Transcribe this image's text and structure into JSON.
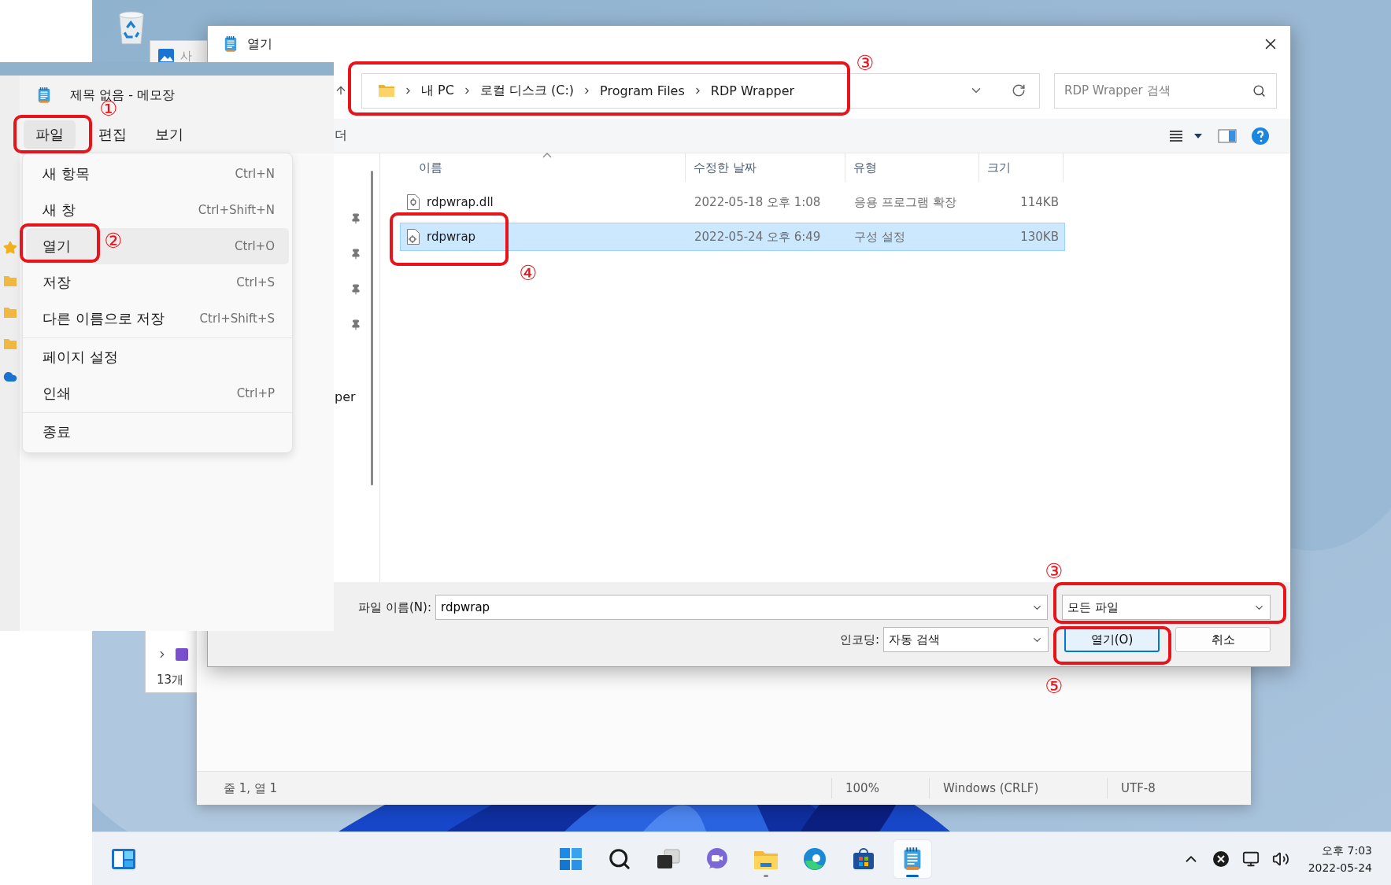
{
  "photo_window": {
    "title": "사"
  },
  "explorer_window": {
    "status": "13개"
  },
  "open_dialog": {
    "title": "열기",
    "breadcrumb": [
      "내 PC",
      "로컬 디스크 (C:)",
      "Program Files",
      "RDP Wrapper"
    ],
    "search": {
      "placeholder": "RDP Wrapper 검색"
    },
    "toolbar_text": "더",
    "nav_text": "per",
    "columns": [
      {
        "label": "이름",
        "sorted": true
      },
      {
        "label": "수정한 날짜",
        "sorted": false
      },
      {
        "label": "유형",
        "sorted": false
      },
      {
        "label": "크기",
        "sorted": false
      }
    ],
    "files": [
      {
        "name": "rdpwrap.dll",
        "modified": "2022-05-18 오후 1:08",
        "type": "응용 프로그램 확장",
        "size": "114KB",
        "kind": "dll",
        "selected": false
      },
      {
        "name": "rdpwrap",
        "modified": "2022-05-24 오후 6:49",
        "type": "구성 설정",
        "size": "130KB",
        "kind": "config",
        "selected": true
      }
    ],
    "file_name": {
      "label": "파일 이름(N):",
      "value": "rdpwrap"
    },
    "file_type": {
      "value": "모든 파일"
    },
    "encoding": {
      "label": "인코딩:",
      "value": "자동 검색"
    },
    "buttons": [
      {
        "label": "열기(O)",
        "default": true
      },
      {
        "label": "취소",
        "default": false
      }
    ]
  },
  "notepad_menu_window": {
    "title": "제목 없음 - 메모장",
    "menu": [
      {
        "label": "파일",
        "selected": true
      },
      {
        "label": "편집",
        "selected": false
      },
      {
        "label": "보기",
        "selected": false
      }
    ],
    "file_menu": [
      [
        {
          "label": "새 항목",
          "shortcut": "Ctrl+N",
          "hovered": false
        },
        {
          "label": "새 창",
          "shortcut": "Ctrl+Shift+N",
          "hovered": false
        },
        {
          "label": "열기",
          "shortcut": "Ctrl+O",
          "hovered": true
        },
        {
          "label": "저장",
          "shortcut": "Ctrl+S",
          "hovered": false
        },
        {
          "label": "다른 이름으로 저장",
          "shortcut": "Ctrl+Shift+S",
          "hovered": false
        }
      ],
      [
        {
          "label": "페이지 설정",
          "hovered": false
        },
        {
          "label": "인쇄",
          "shortcut": "Ctrl+P",
          "hovered": false
        }
      ],
      [
        {
          "label": "종료",
          "hovered": false
        }
      ]
    ]
  },
  "notepad_status": [
    "줄 1, 열 1",
    "100%",
    "Windows (CRLF)",
    "UTF-8"
  ],
  "annotations": [
    {
      "label": "①"
    },
    {
      "label": "②"
    },
    {
      "label": "③"
    },
    {
      "label": "④"
    },
    {
      "label": "③"
    },
    {
      "label": "⑤"
    }
  ],
  "taskbar": {
    "apps": [
      {
        "kind": "start",
        "active": false,
        "running": false
      },
      {
        "kind": "search",
        "active": false,
        "running": false
      },
      {
        "kind": "taskview",
        "active": false,
        "running": false
      },
      {
        "kind": "chat",
        "active": false,
        "running": false
      },
      {
        "kind": "explorer",
        "active": false,
        "running": true
      },
      {
        "kind": "edge",
        "active": false,
        "running": false
      },
      {
        "kind": "store",
        "active": false,
        "running": false
      },
      {
        "kind": "notepad",
        "active": true,
        "running": true
      }
    ],
    "clock": {
      "time": "오후 7:03",
      "date": "2022-05-24"
    }
  }
}
